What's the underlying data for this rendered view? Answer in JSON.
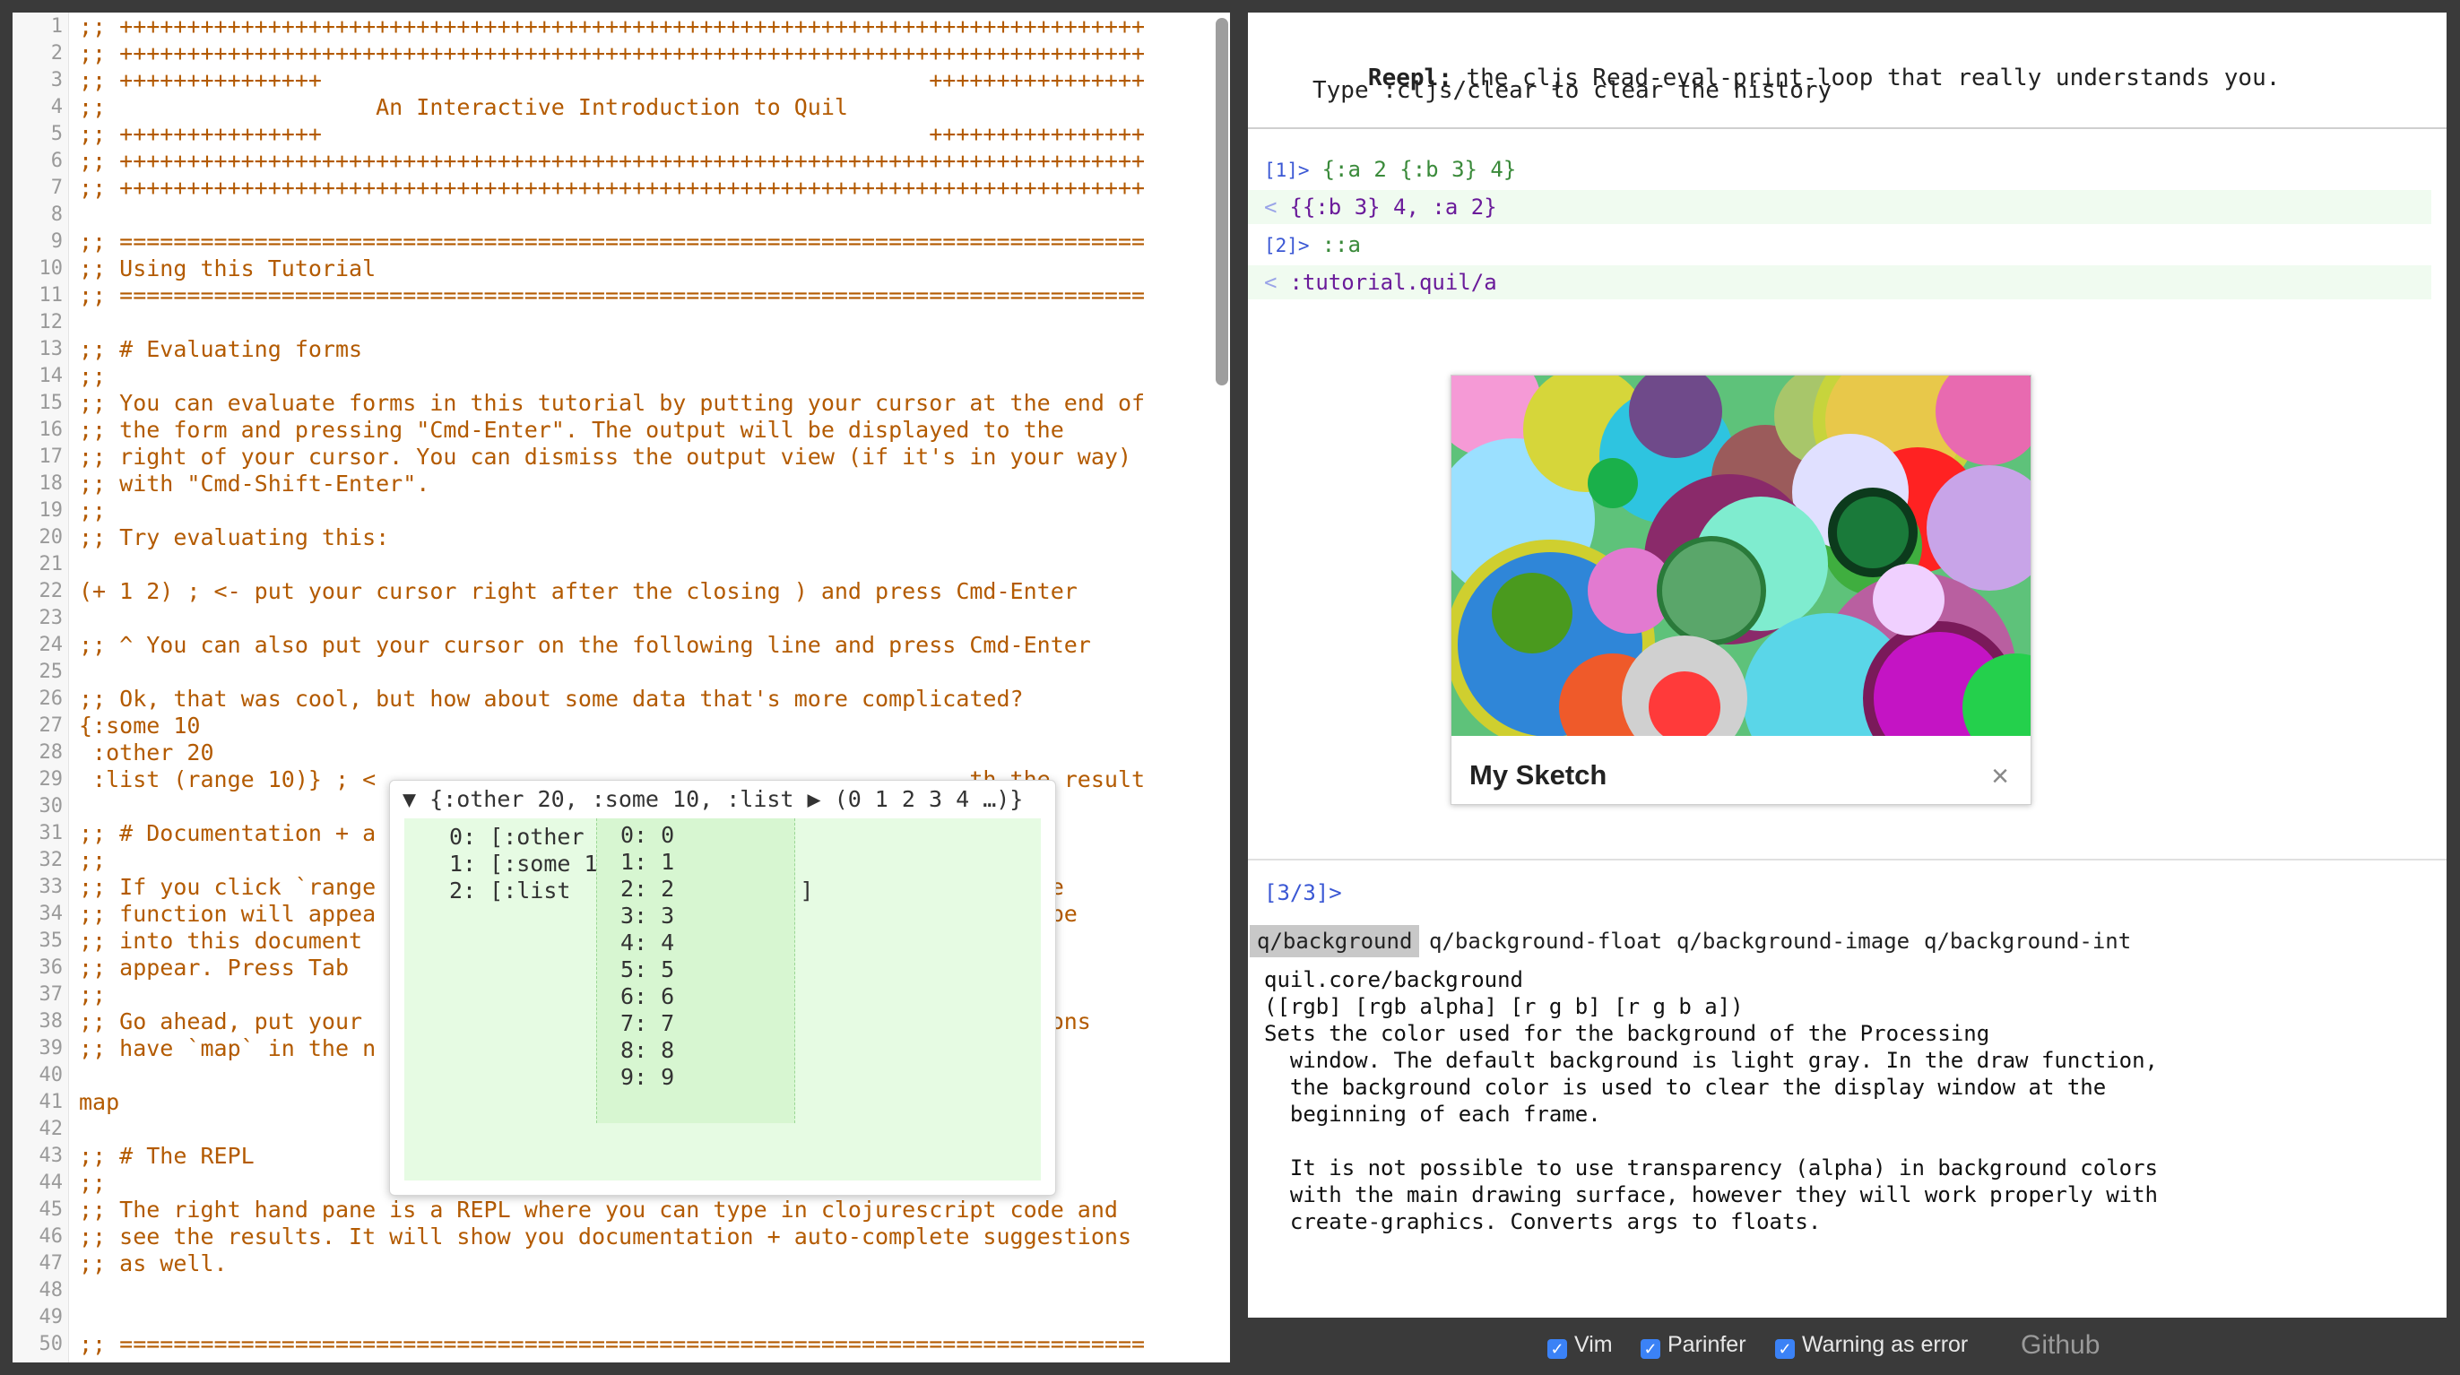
{
  "editor": {
    "lines": [
      ";; ++++++++++++++++++++++++++++++++++++++++++++++++++++++++++++++++++++++++++++",
      ";; ++++++++++++++++++++++++++++++++++++++++++++++++++++++++++++++++++++++++++++",
      ";; +++++++++++++++                                             ++++++++++++++++",
      ";;                    An Interactive Introduction to Quil",
      ";; +++++++++++++++                                             ++++++++++++++++",
      ";; ++++++++++++++++++++++++++++++++++++++++++++++++++++++++++++++++++++++++++++",
      ";; ++++++++++++++++++++++++++++++++++++++++++++++++++++++++++++++++++++++++++++",
      "",
      ";; ============================================================================",
      ";; Using this Tutorial",
      ";; ============================================================================",
      "",
      ";; # Evaluating forms",
      ";;",
      ";; You can evaluate forms in this tutorial by putting your cursor at the end of",
      ";; the form and pressing \"Cmd-Enter\". The output will be displayed to the",
      ";; right of your cursor. You can dismiss the output view (if it's in your way)",
      ";; with \"Cmd-Shift-Enter\".",
      ";;",
      ";; Try evaluating this:",
      "",
      "(+ 1 2) ; <- put your cursor right after the closing ) and press Cmd-Enter",
      "",
      ";; ^ You can also put your cursor on the following line and press Cmd-Enter",
      "",
      ";; Ok, that was cool, but how about some data that's more complicated?",
      "{:some 10",
      " :other 20",
      " :list (range 10)} ; <                                            th the result",
      "",
      ";; # Documentation + a",
      ";;",
      ";; If you click `range                                            e range",
      ";; function will appea                                            can type",
      ";; into this document                                             will",
      ";; appear. Press Tab                                              .",
      ";;",
      ";; Go ahead, put your                                             functions",
      ";; have `map` in the n",
      "",
      "map",
      "",
      ";; # The REPL",
      ";;",
      ";; The right hand pane is a REPL where you can type in clojurescript code and",
      ";; see the results. It will show you documentation + auto-complete suggestions",
      ";; as well.",
      "",
      "",
      ";; ============================================================================"
    ]
  },
  "popup": {
    "header": "▼ {:other 20, :some 10, :list ▶ (0 1 2 3 4 …)}",
    "entries": [
      "0: [:other 20]",
      "1: [:some 10]",
      "2: [:list  ▼ (0 1 2 3 4 …)]"
    ],
    "list_items": [
      "0: 0",
      "1: 1",
      "2: 2",
      "3: 3",
      "4: 4",
      "5: 5",
      "6: 6",
      "7: 7",
      "8: 8",
      "9: 9"
    ]
  },
  "repl": {
    "title": "Reepl:",
    "tagline": " the cljs Read-eval-print-loop that really understands you.",
    "hint": "Type :cljs/clear to clear the history",
    "history": [
      {
        "kind": "in",
        "prompt": "[1]>",
        "text": "{:a 2 {:b 3} 4}"
      },
      {
        "kind": "out",
        "prompt": "<",
        "text": "{{:b 3} 4, :a 2}"
      },
      {
        "kind": "in",
        "prompt": "[2]>",
        "text": "::a"
      },
      {
        "kind": "out",
        "prompt": "<",
        "text": ":tutorial.quil/a"
      }
    ],
    "sketch": {
      "title": "My Sketch",
      "close": "×"
    },
    "current_prompt": "[3/3]>",
    "completions": [
      "q/background",
      "q/background-float",
      "q/background-image",
      "q/background-int"
    ],
    "selected_completion": "q/background",
    "doc": [
      "quil.core/background",
      "([rgb] [rgb alpha] [r g b] [r g b a])",
      "Sets the color used for the background of the Processing",
      "  window. The default background is light gray. In the draw function,",
      "  the background color is used to clear the display window at the",
      "  beginning of each frame.",
      "",
      "  It is not possible to use transparency (alpha) in background colors",
      "  with the main drawing surface, however they will work properly with",
      "  create-graphics. Converts args to floats."
    ]
  },
  "footer": {
    "options": [
      "Vim",
      "Parinfer",
      "Warning as error"
    ],
    "github": "Github"
  },
  "colors": {
    "comment": "#b35a00",
    "prompt": "#3a57d4",
    "checkbox": "#3b82f6",
    "result_bg": "#e6fbe3"
  }
}
